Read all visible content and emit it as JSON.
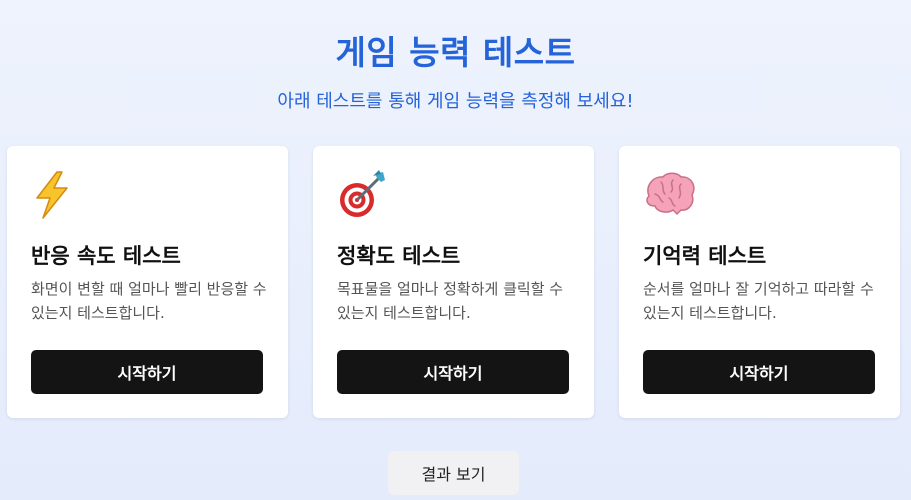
{
  "header": {
    "title": "게임 능력 테스트",
    "subtitle": "아래 테스트를 통해 게임 능력을 측정해 보세요!"
  },
  "cards": [
    {
      "icon": "lightning-icon",
      "title": "반응 속도 테스트",
      "description": "화면이 변할 때 얼마나 빨리 반응할 수 있는지 테스트합니다.",
      "button_label": "시작하기"
    },
    {
      "icon": "target-dart-icon",
      "title": "정확도 테스트",
      "description": "목표물을 얼마나 정확하게 클릭할 수 있는지 테스트합니다.",
      "button_label": "시작하기"
    },
    {
      "icon": "brain-icon",
      "title": "기억력 테스트",
      "description": "순서를 얼마나 잘 기억하고 따라할 수 있는지 테스트합니다.",
      "button_label": "시작하기"
    }
  ],
  "footer": {
    "results_label": "결과 보기"
  },
  "colors": {
    "accent": "#2563d9",
    "button_dark": "#141414",
    "background": "#eef3fd"
  }
}
